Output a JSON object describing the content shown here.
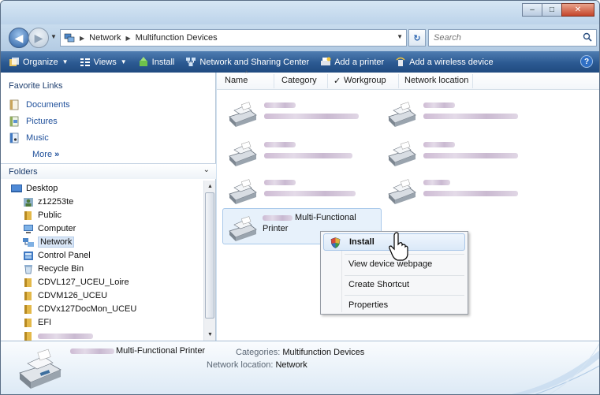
{
  "window": {
    "controls": {
      "minimize": "–",
      "maximize": "□",
      "close": "✕"
    }
  },
  "address": {
    "crumbs": [
      "Network",
      "Multifunction Devices"
    ],
    "refresh_glyph": "↻",
    "search_placeholder": "Search"
  },
  "toolbar": {
    "items": [
      {
        "label": "Organize",
        "icon": "organize-icon",
        "has_dropdown": true
      },
      {
        "label": "Views",
        "icon": "views-icon",
        "has_dropdown": true
      },
      {
        "label": "Install",
        "icon": "install-icon",
        "has_dropdown": false
      },
      {
        "label": "Network and Sharing Center",
        "icon": "network-center-icon",
        "has_dropdown": false
      },
      {
        "label": "Add a printer",
        "icon": "add-printer-icon",
        "has_dropdown": false
      },
      {
        "label": "Add a wireless device",
        "icon": "wireless-device-icon",
        "has_dropdown": false
      }
    ],
    "help": "?"
  },
  "sidebar": {
    "favorites_title": "Favorite Links",
    "favorites": [
      "Documents",
      "Pictures",
      "Music"
    ],
    "more": "More",
    "more_glyph": "»",
    "folders_title": "Folders",
    "tree": [
      "Desktop",
      "z12253te",
      "Public",
      "Computer",
      "Network",
      "Control Panel",
      "Recycle Bin",
      "CDVL127_UCEU_Loire",
      "CDVM126_UCEU",
      "CDVx127DocMon_UCEU",
      "EFI"
    ],
    "selected": "Network"
  },
  "columns": [
    "Name",
    "Category",
    "Workgroup",
    "Network location"
  ],
  "checked_column": "Workgroup",
  "devices": {
    "selected_name_line1": "Multi-Functional",
    "selected_name_line2": "Printer"
  },
  "context_menu": {
    "items": [
      "Install",
      "View device webpage",
      "Create Shortcut",
      "Properties"
    ],
    "highlighted": "Install"
  },
  "details": {
    "name": "Multi-Functional Printer",
    "categories_label": "Categories:",
    "categories_value": "Multifunction Devices",
    "location_label": "Network location:",
    "location_value": "Network"
  },
  "colors": {
    "toolbar": "#2c5a92",
    "link": "#1e4f9a",
    "selection": "#e7f1fb"
  }
}
